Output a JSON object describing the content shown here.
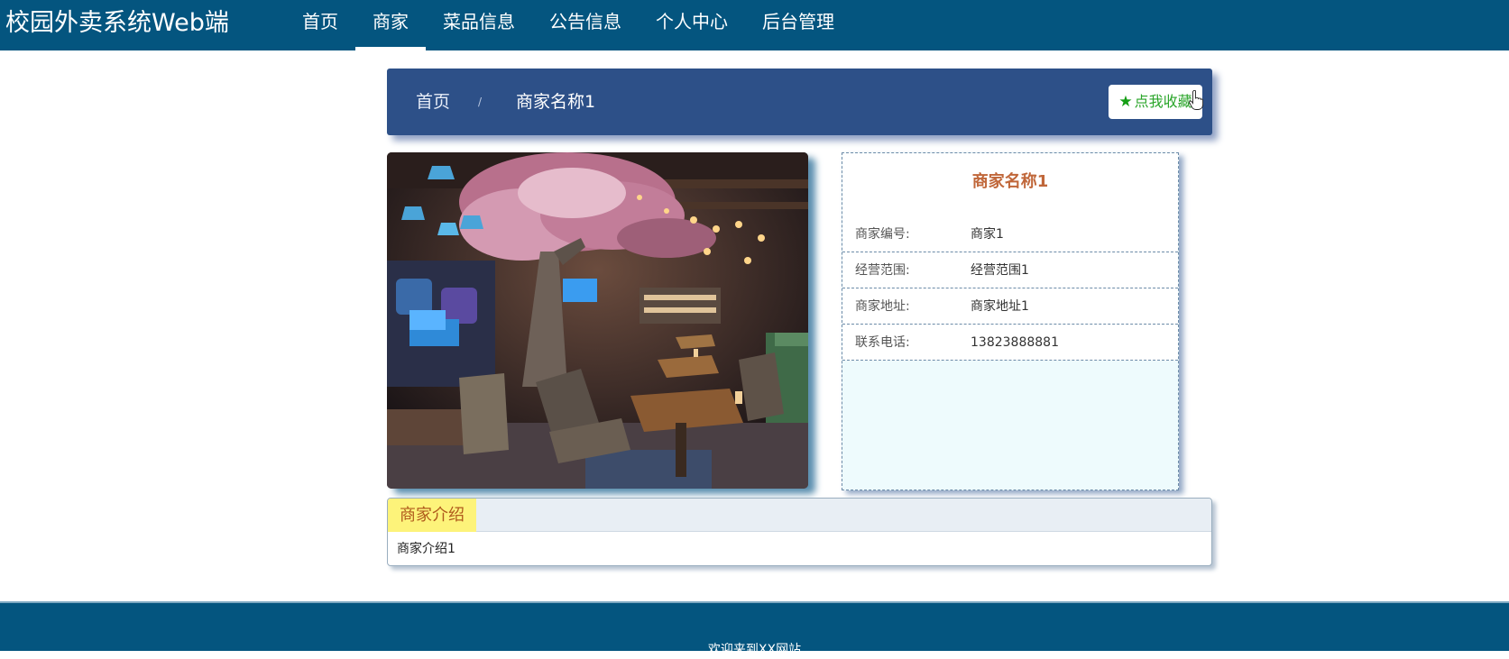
{
  "header": {
    "brand": "校园外卖系统Web端",
    "nav": [
      "首页",
      "商家",
      "菜品信息",
      "公告信息",
      "个人中心",
      "后台管理"
    ],
    "active_nav": "商家"
  },
  "breadcrumb": {
    "home": "首页",
    "separator": "/",
    "current": "商家名称1"
  },
  "favorite_button": {
    "icon": "star-icon",
    "label": "点我收藏"
  },
  "shop": {
    "name": "商家名称1",
    "fields": [
      {
        "label": "商家编号:",
        "value": "商家1"
      },
      {
        "label": "经营范围:",
        "value": "经营范围1"
      },
      {
        "label": "商家地址:",
        "value": "商家地址1"
      },
      {
        "label": "联系电话:",
        "value": "13823888881"
      }
    ]
  },
  "intro": {
    "tab": "商家介绍",
    "content": "商家介绍1"
  },
  "footer": {
    "text": "欢迎来到XX网站"
  },
  "colors": {
    "nav_bg": "#04557f",
    "breadcrumb_bg": "#2d5088",
    "title_accent": "#c0673a",
    "favorite_green": "#2aa52a",
    "intro_tab_bg": "#fdf37a",
    "info_bg": "#eefbfd"
  }
}
